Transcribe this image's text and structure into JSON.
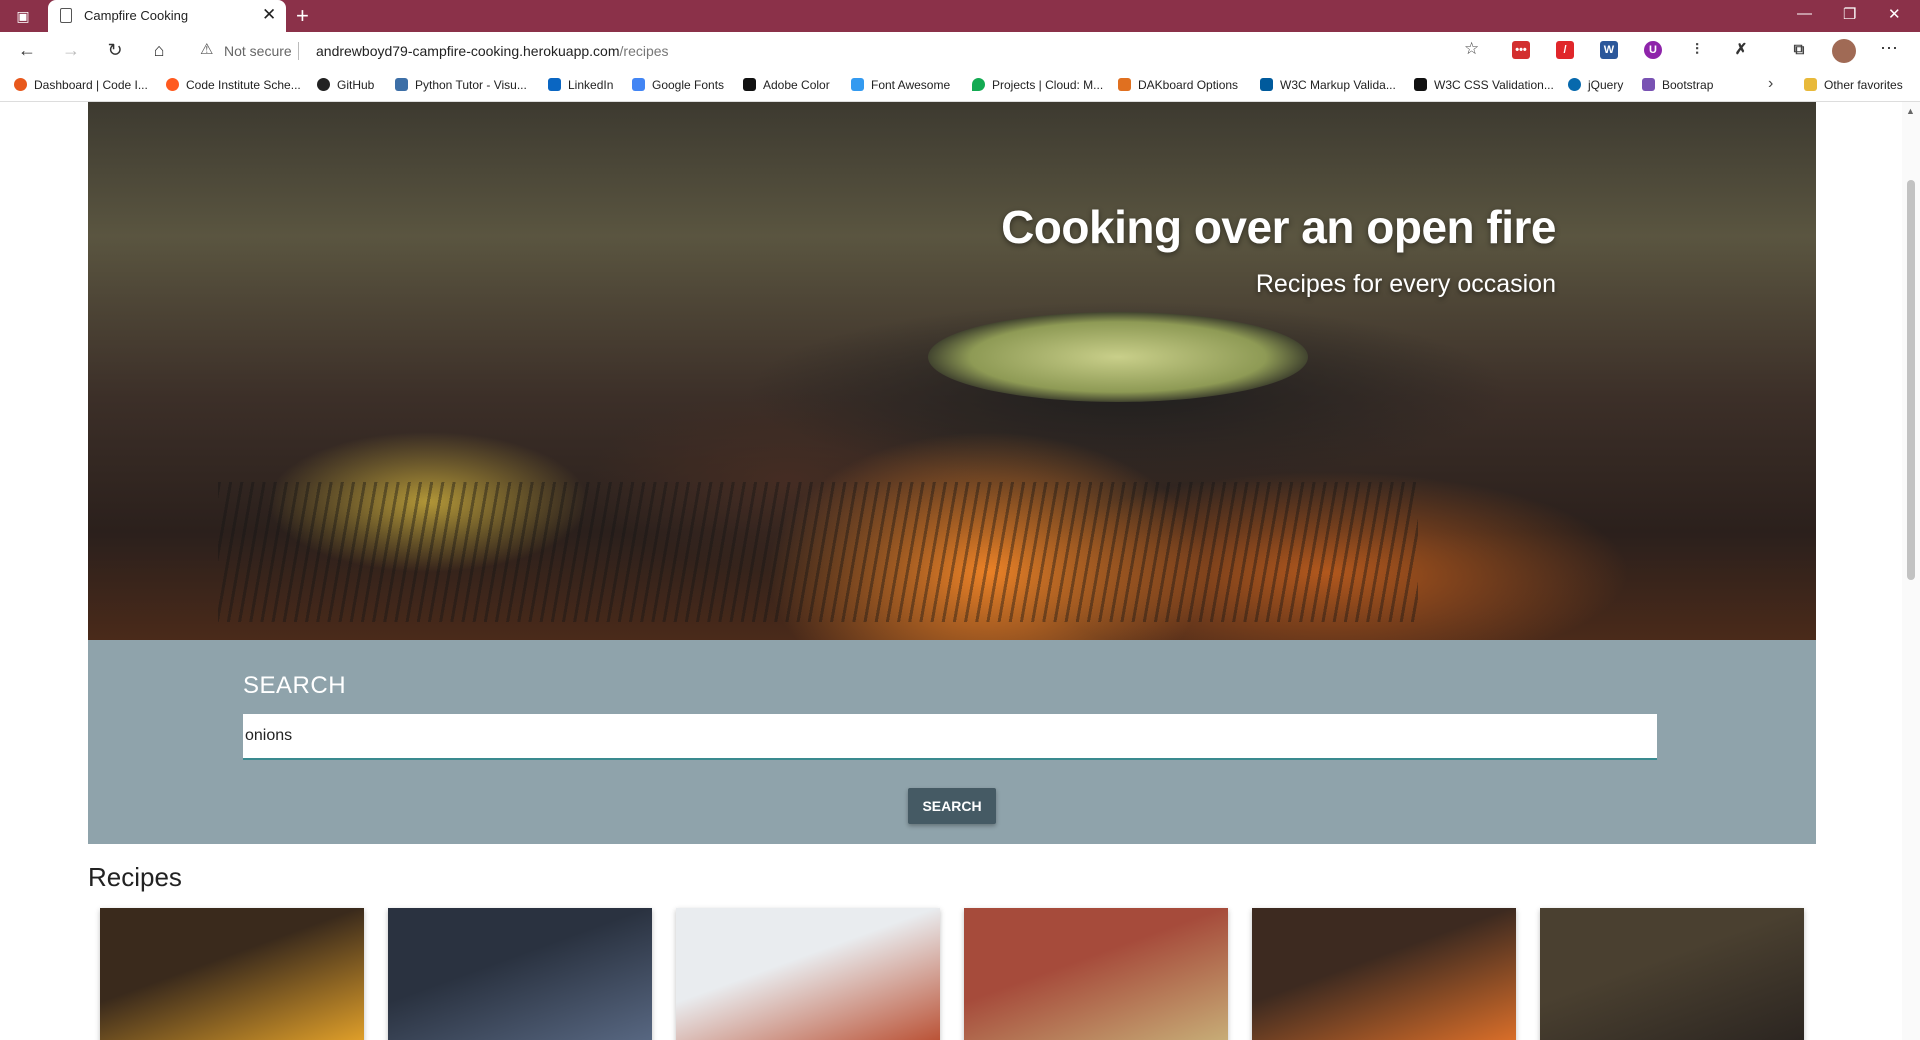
{
  "browser": {
    "tab_title": "Campfire Cooking",
    "new_tab_symbol": "+",
    "close_symbol": "✕",
    "window_controls": [
      "—",
      "❐",
      "✕"
    ],
    "security_label": "Not secure",
    "url_host": "andrewboyd79-campfire-cooking.herokuapp.com",
    "url_path": "/recipes",
    "nav": {
      "back": "←",
      "forward": "→",
      "reload": "↻",
      "home": "⌂"
    },
    "bookmarks": [
      {
        "label": "Dashboard | Code I...",
        "color": "#e8581c"
      },
      {
        "label": "Code Institute Sche...",
        "color": "#ff5a1f"
      },
      {
        "label": "GitHub",
        "color": "#222222"
      },
      {
        "label": "Python Tutor - Visu...",
        "color": "#3d6fa7"
      },
      {
        "label": "LinkedIn",
        "color": "#0a66c2"
      },
      {
        "label": "Google Fonts",
        "color": "#4285f4"
      },
      {
        "label": "Adobe Color",
        "color": "#111111"
      },
      {
        "label": "Font Awesome",
        "color": "#339af0"
      },
      {
        "label": "Projects | Cloud: M...",
        "color": "#13aa52"
      },
      {
        "label": "DAKboard Options",
        "color": "#e07020"
      },
      {
        "label": "W3C Markup Valida...",
        "color": "#005a9c"
      },
      {
        "label": "W3C CSS Validation...",
        "color": "#111111"
      },
      {
        "label": "jQuery",
        "color": "#0769ad"
      },
      {
        "label": "Bootstrap",
        "color": "#7952b3"
      }
    ],
    "other_favorites": "Other favorites"
  },
  "hero": {
    "title": "Cooking over an open fire",
    "subtitle": "Recipes for every occasion"
  },
  "search": {
    "label": "SEARCH",
    "value": "onions",
    "button": "SEARCH"
  },
  "recipes": {
    "heading": "Recipes",
    "cards": [
      {
        "image": "grilled-corn",
        "colors": [
          "#3a2a1c",
          "#e8a52a"
        ]
      },
      {
        "image": "mussels",
        "colors": [
          "#2a3240",
          "#5a6a85"
        ]
      },
      {
        "image": "tomato-stew",
        "colors": [
          "#e9ecef",
          "#b84a2c"
        ]
      },
      {
        "image": "baked-dish",
        "colors": [
          "#a64b3b",
          "#c9b27a"
        ]
      },
      {
        "image": "roasted-sweet-potato",
        "colors": [
          "#3d2a20",
          "#e2722a"
        ]
      },
      {
        "image": "skillet-over-fire",
        "colors": [
          "#4a4030",
          "#2a2420"
        ]
      }
    ]
  }
}
